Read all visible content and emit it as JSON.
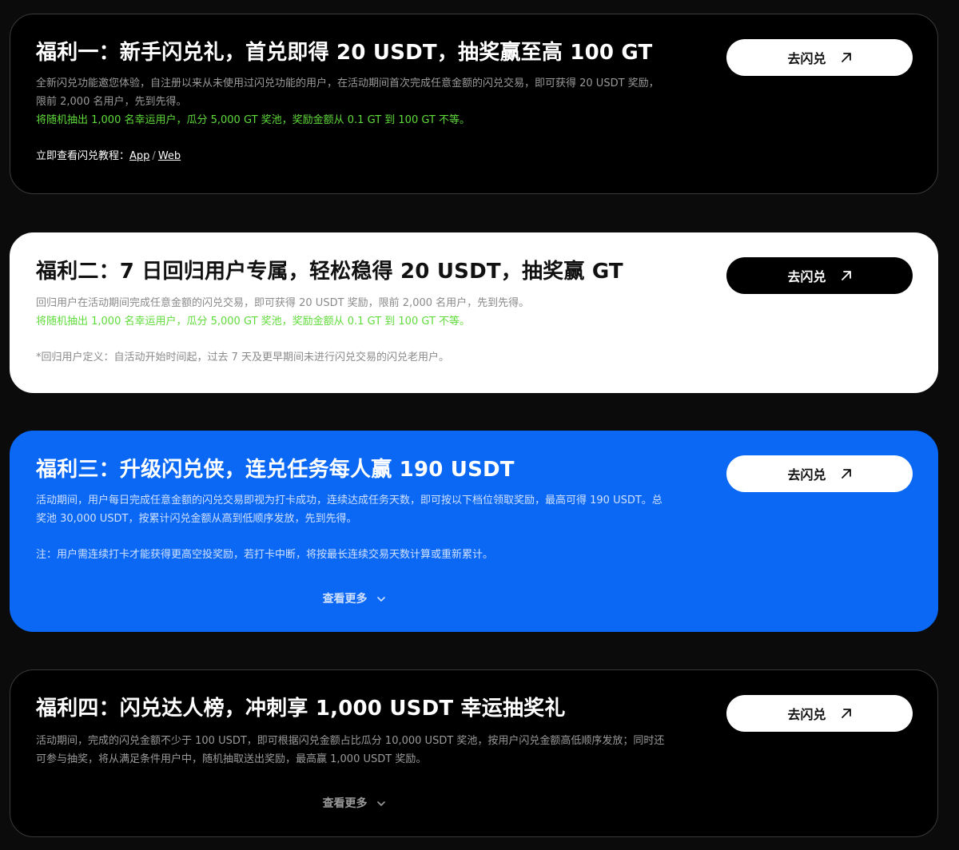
{
  "cards": [
    {
      "title": "福利一：新手闪兑礼，首兑即得 20 USDT，抽奖赢至高 100 GT",
      "description": "全新闪兑功能邀您体验，自注册以来从未使用过闪兑功能的用户，在活动期间首次完成任意金额的闪兑交易，即可获得 20 USDT 奖励，限前 2,000 名用户，先到先得。",
      "highlight": "将随机抽出 1,000 名幸运用户，瓜分 5,000 GT 奖池，奖励金额从 0.1 GT 到 100 GT 不等。",
      "tutorial_label": "立即查看闪兑教程：",
      "tutorial_app": "App",
      "tutorial_sep": "/",
      "tutorial_web": "Web",
      "cta_label": "去闪兑"
    },
    {
      "title": "福利二：7 日回归用户专属，轻松稳得 20 USDT，抽奖赢 GT",
      "description": "回归用户在活动期间完成任意金额的闪兑交易，即可获得 20 USDT 奖励，限前 2,000 名用户，先到先得。",
      "highlight": "将随机抽出 1,000 名幸运用户，瓜分 5,000 GT 奖池，奖励金额从 0.1 GT 到 100 GT 不等。",
      "note": "*回归用户定义：自活动开始时间起，过去 7 天及更早期间未进行闪兑交易的闪兑老用户。",
      "cta_label": "去闪兑"
    },
    {
      "title": "福利三：升级闪兑侠，连兑任务每人赢 190 USDT",
      "description": "活动期间，用户每日完成任意金额的闪兑交易即视为打卡成功，连续达成任务天数，即可按以下档位领取奖励，最高可得 190 USDT。总奖池 30,000 USDT，按累计闪兑金额从高到低顺序发放，先到先得。",
      "note": "注：用户需连续打卡才能获得更高空投奖励，若打卡中断，将按最长连续交易天数计算或重新累计。",
      "more_label": "查看更多",
      "cta_label": "去闪兑"
    },
    {
      "title": "福利四：闪兑达人榜，冲刺享 1,000 USDT 幸运抽奖礼",
      "description": "活动期间，完成的闪兑金额不少于 100 USDT，即可根据闪兑金额占比瓜分 10,000 USDT 奖池，按用户闪兑金额高低顺序发放；同时还可参与抽奖，将从满足条件用户中，随机抽取送出奖励，最高赢 1,000 USDT 奖励。",
      "more_label": "查看更多",
      "cta_label": "去闪兑"
    }
  ],
  "icons": {
    "cta_icon": "arrow-up-right-icon",
    "more_icon": "chevron-down-icon"
  },
  "colors": {
    "page_bg": "#0b0b0b",
    "dark_card": "#000000",
    "light_card": "#ffffff",
    "blue_card": "#0a68f5",
    "highlight_green": "#5fdc3a"
  }
}
